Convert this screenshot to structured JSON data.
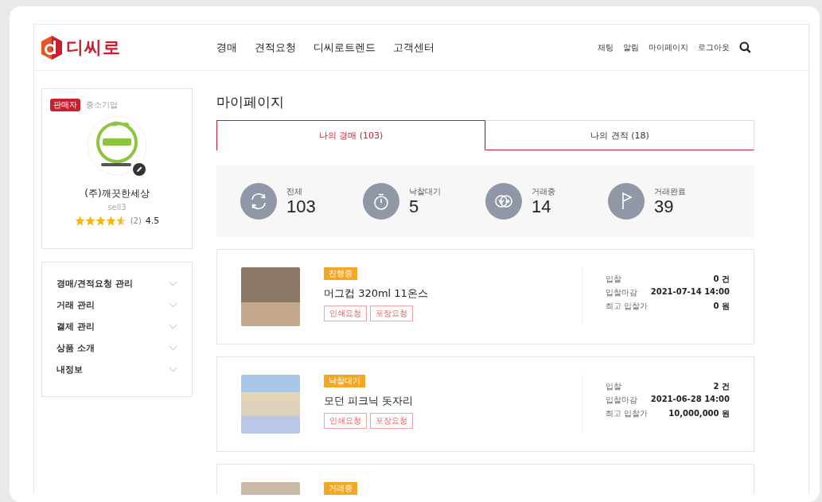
{
  "header": {
    "logo": "디씨로",
    "nav": [
      "경매",
      "견적요청",
      "디씨로트렌드",
      "고객센터"
    ],
    "links": [
      "채팅",
      "알림",
      "마이페이지",
      "로그아웃"
    ]
  },
  "profile": {
    "badge": "판매자",
    "type": "중소기업",
    "name": "(주)깨끗한세상",
    "id": "sell3",
    "stars": 4.5,
    "count": "(2)",
    "rating": "4.5"
  },
  "menu": [
    {
      "label": "경매/견적요청 관리",
      "expanded": false
    },
    {
      "label": "거래 관리",
      "expanded": false
    },
    {
      "label": "결제 관리",
      "expanded": false
    },
    {
      "label": "상품 소개",
      "expanded": false
    },
    {
      "label": "내정보",
      "expanded": false
    }
  ],
  "page_title": "마이페이지",
  "tabs": [
    {
      "label": "나의 경매 (103)",
      "selected": true
    },
    {
      "label": "나의 견적 (18)",
      "selected": false
    }
  ],
  "stats": [
    {
      "kind": "all",
      "label": "전체",
      "value": "103"
    },
    {
      "kind": "waiting",
      "label": "낙찰대기",
      "value": "5"
    },
    {
      "kind": "trading",
      "label": "거래중",
      "value": "14"
    },
    {
      "kind": "done",
      "label": "거래완료",
      "value": "39"
    }
  ],
  "items": [
    {
      "status": "진행중",
      "title": "머그컵 320ml 11온스",
      "tags": [
        "인쇄요청",
        "포장요청"
      ],
      "details": [
        {
          "label": "입찰",
          "value": "0 건"
        },
        {
          "label": "입찰마감",
          "value": "2021-07-14 14:00"
        },
        {
          "label": "최고 입찰가",
          "value": "0 원"
        }
      ]
    },
    {
      "status": "낙찰대기",
      "title": "모던 피크닉 돗자리",
      "tags": [
        "인쇄요청",
        "포장요청"
      ],
      "details": [
        {
          "label": "입찰",
          "value": "2 건"
        },
        {
          "label": "입찰마감",
          "value": "2021-06-28 14:00"
        },
        {
          "label": "최고 입찰가",
          "value": "10,000,000 원"
        }
      ]
    },
    {
      "status": "거래중"
    }
  ]
}
